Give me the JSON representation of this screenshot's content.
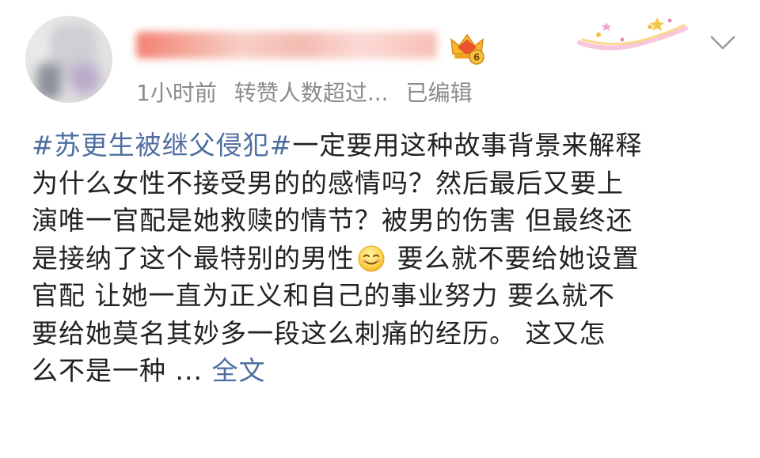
{
  "post": {
    "meta": {
      "time": "1小时前",
      "reposts": "转赞人数超过...",
      "edited": "已编辑"
    },
    "badge": {
      "level": "6"
    },
    "content": {
      "hashtag": "#苏更生被继父侵犯#",
      "line1_rest": "一定要用这种故事背景来解释",
      "line2": "为什么女性不接受男的的感情吗？然后最后又要上",
      "line3": "演唯一官配是她救赎的情节？被男的伤害 但最终还",
      "line4_before_emoji": "是接纳了这个最特别的男性",
      "line4_after_emoji": " 要么就不要给她设置",
      "line5": "官配 让她一直为正义和自己的事业努力 要么就不",
      "line6": "要给她莫名其妙多一段这么刺痛的经历。 这又怎",
      "line7_start": "么不是一种 ... ",
      "full_text_link": "全文"
    },
    "icons": {
      "avatar": "avatar-image",
      "badge": "crown-badge-icon",
      "decor": "sparkle-decoration-icon",
      "more": "chevron-down-icon",
      "emoji": "smile-emoji-icon"
    }
  }
}
